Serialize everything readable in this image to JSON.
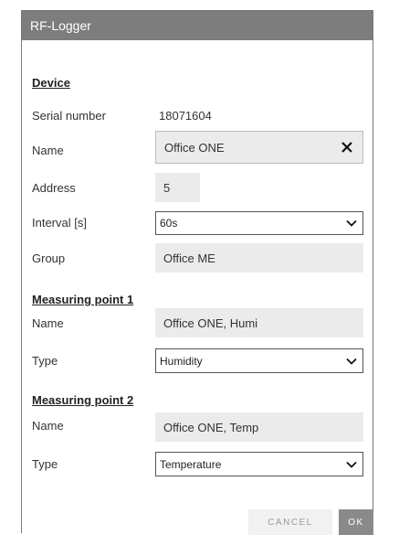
{
  "window": {
    "title": "RF-Logger"
  },
  "device": {
    "heading": "Device",
    "serial_label": "Serial number",
    "serial_value": "18071604",
    "name_label": "Name",
    "name_value": "Office ONE",
    "address_label": "Address",
    "address_value": "5",
    "interval_label": "Interval [s]",
    "interval_value": "60s",
    "group_label": "Group",
    "group_value": "Office ME"
  },
  "mp1": {
    "heading": "Measuring point 1",
    "name_label": "Name",
    "name_value": "Office ONE, Humi",
    "type_label": "Type",
    "type_value": "Humidity"
  },
  "mp2": {
    "heading": "Measuring point 2",
    "name_label": "Name",
    "name_value": "Office ONE, Temp",
    "type_label": "Type",
    "type_value": "Temperature"
  },
  "footer": {
    "cancel_label": "CANCEL",
    "ok_label": "OK"
  },
  "icons": {
    "clear": "close-icon",
    "dropdown": "chevron-down-icon"
  },
  "colors": {
    "titlebar": "#7d7d7d",
    "field_bg": "#ebebeb",
    "ok_button": "#8a8a8a",
    "cancel_button": "#f1f1f1"
  }
}
